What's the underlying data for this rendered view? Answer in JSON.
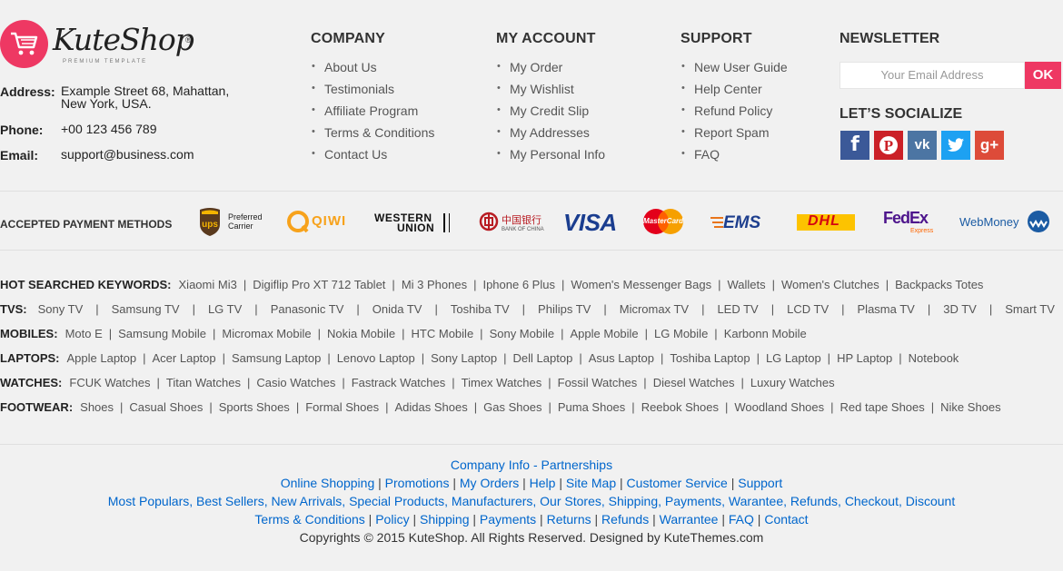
{
  "brand": {
    "name": "KuteShop",
    "tagline": "PREMIUM TEMPLATE",
    "reg": "®",
    "brand_color": "#ee3863"
  },
  "contact": {
    "address_label": "Address:",
    "address_line1": "Example Street 68, Mahattan,",
    "address_line2": "New York, USA.",
    "phone_label": "Phone:",
    "phone": "+00 123 456 789",
    "email_label": "Email:",
    "email": "support@business.com"
  },
  "columns": [
    {
      "title": "COMPANY",
      "items": [
        "About Us",
        "Testimonials",
        "Affiliate Program",
        "Terms & Conditions",
        "Contact Us"
      ]
    },
    {
      "title": "MY ACCOUNT",
      "items": [
        "My Order",
        "My Wishlist",
        "My Credit Slip",
        "My Addresses",
        "My Personal Info"
      ]
    },
    {
      "title": "SUPPORT",
      "items": [
        "New User Guide",
        "Help Center",
        "Refund Policy",
        "Report Spam",
        "FAQ"
      ]
    }
  ],
  "newsletter": {
    "title": "NEWSLETTER",
    "placeholder": "Your Email Address",
    "button": "OK",
    "social_title": "LET’S SOCIALIZE",
    "social": [
      {
        "icon": "facebook-icon",
        "glyph": "f",
        "color": "#3b5998"
      },
      {
        "icon": "pinterest-icon",
        "glyph": "P",
        "color": "#cb2027"
      },
      {
        "icon": "vk-icon",
        "glyph": "vk",
        "color": "#4c75a3"
      },
      {
        "icon": "twitter-icon",
        "glyph": "t",
        "color": "#1da1f2"
      },
      {
        "icon": "google-plus-icon",
        "glyph": "g+",
        "color": "#dd4b39"
      }
    ]
  },
  "payments": {
    "label": "ACCEPTED PAYMENT METHODS",
    "methods": [
      "ups-logo",
      "qiwi-logo",
      "western-union-logo",
      "bank-of-china-logo",
      "visa-logo",
      "mastercard-logo",
      "ems-logo",
      "dhl-logo",
      "fedex-logo",
      "webmoney-logo"
    ],
    "ups_text": "Preferred Carrier",
    "qiwi_text": "QIWI",
    "wu_line1": "WESTERN",
    "wu_line2": "UNION",
    "boc_text": "中国银行",
    "boc_sub": "BANK OF CHINA",
    "visa_text": "VISA",
    "mc_text": "MasterCard",
    "ems_text": "EMS",
    "dhl_text": "DHL",
    "fedex_text": "FedEx",
    "fedex_sub": "Express",
    "webmoney_text": "WebMoney"
  },
  "keywords": [
    {
      "label": "HOT SEARCHED KEYWORDS:",
      "items": [
        "Xiaomi Mi3",
        "Digiflip Pro XT 712 Tablet",
        "Mi 3 Phones",
        "Iphone 6 Plus",
        "Women's Messenger Bags",
        "Wallets",
        "Women's Clutches",
        "Backpacks Totes"
      ]
    },
    {
      "label": "TVS:",
      "items": [
        "Sony TV",
        "Samsung TV",
        "LG TV",
        "Panasonic TV",
        "Onida TV",
        "Toshiba TV",
        "Philips TV",
        "Micromax TV",
        "LED TV",
        "LCD TV",
        "Plasma TV",
        "3D TV",
        "Smart TV"
      ]
    },
    {
      "label": "MOBILES:",
      "items": [
        "Moto E",
        "Samsung Mobile",
        "Micromax Mobile",
        "Nokia Mobile",
        "HTC Mobile",
        "Sony Mobile",
        "Apple Mobile",
        "LG Mobile",
        "Karbonn Mobile"
      ]
    },
    {
      "label": "LAPTOPS:",
      "items": [
        "Apple Laptop",
        "Acer Laptop",
        "Samsung Laptop",
        "Lenovo Laptop",
        "Sony Laptop",
        "Dell Laptop",
        "Asus Laptop",
        "Toshiba Laptop",
        "LG Laptop",
        "HP Laptop",
        "Notebook"
      ]
    },
    {
      "label": "WATCHES:",
      "items": [
        "FCUK Watches",
        "Titan Watches",
        "Casio Watches",
        "Fastrack Watches",
        "Timex Watches",
        "Fossil Watches",
        "Diesel Watches",
        "Luxury Watches"
      ]
    },
    {
      "label": "FOOTWEAR:",
      "items": [
        "Shoes",
        "Casual Shoes",
        "Sports Shoes",
        "Formal Shoes",
        "Adidas Shoes",
        "Gas Shoes",
        "Puma Shoes",
        "Reebok Shoes",
        "Woodland Shoes",
        "Red tape Shoes",
        "Nike Shoes"
      ]
    }
  ],
  "bottom": {
    "line1": [
      "Company Info - Partnerships"
    ],
    "line2": [
      "Online Shopping",
      "Promotions",
      "My Orders",
      "Help",
      "Site Map",
      "Customer Service",
      "Support"
    ],
    "line3": "Most Populars, Best Sellers, New Arrivals, Special Products, Manufacturers, Our Stores, Shipping, Payments, Warantee, Refunds, Checkout, Discount",
    "line4": [
      "Terms & Conditions",
      "Policy",
      "Shipping",
      "Payments",
      "Returns",
      "Refunds",
      "Warrantee",
      "FAQ",
      "Contact"
    ],
    "copyright": "Copyrights © 2015 KuteShop. All Rights Reserved. Designed by KuteThemes.com",
    "link_color": "#0066cc"
  }
}
